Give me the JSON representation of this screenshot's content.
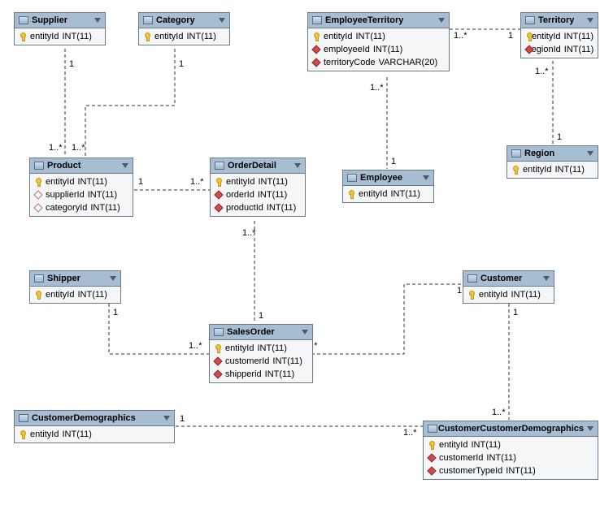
{
  "entities": {
    "supplier": {
      "title": "Supplier",
      "fields": [
        {
          "name": "entityId",
          "type": "INT(11)",
          "icon": "pk"
        }
      ]
    },
    "category": {
      "title": "Category",
      "fields": [
        {
          "name": "entityId",
          "type": "INT(11)",
          "icon": "pk"
        }
      ]
    },
    "employeeTerritory": {
      "title": "EmployeeTerritory",
      "fields": [
        {
          "name": "entityId",
          "type": "INT(11)",
          "icon": "pk"
        },
        {
          "name": "employeeId",
          "type": "INT(11)",
          "icon": "fk"
        },
        {
          "name": "territoryCode",
          "type": "VARCHAR(20)",
          "icon": "fk"
        }
      ]
    },
    "territory": {
      "title": "Territory",
      "fields": [
        {
          "name": "entityId",
          "type": "INT(11)",
          "icon": "pk"
        },
        {
          "name": "regionId",
          "type": "INT(11)",
          "icon": "fk"
        }
      ]
    },
    "product": {
      "title": "Product",
      "fields": [
        {
          "name": "entityId",
          "type": "INT(11)",
          "icon": "pk"
        },
        {
          "name": "supplierId",
          "type": "INT(11)",
          "icon": "fk-o"
        },
        {
          "name": "categoryId",
          "type": "INT(11)",
          "icon": "fk-o"
        }
      ]
    },
    "orderDetail": {
      "title": "OrderDetail",
      "fields": [
        {
          "name": "entityId",
          "type": "INT(11)",
          "icon": "pk"
        },
        {
          "name": "orderId",
          "type": "INT(11)",
          "icon": "fk"
        },
        {
          "name": "productId",
          "type": "INT(11)",
          "icon": "fk"
        }
      ]
    },
    "employee": {
      "title": "Employee",
      "fields": [
        {
          "name": "entityId",
          "type": "INT(11)",
          "icon": "pk"
        }
      ]
    },
    "region": {
      "title": "Region",
      "fields": [
        {
          "name": "entityId",
          "type": "INT(11)",
          "icon": "pk"
        }
      ]
    },
    "shipper": {
      "title": "Shipper",
      "fields": [
        {
          "name": "entityId",
          "type": "INT(11)",
          "icon": "pk"
        }
      ]
    },
    "salesOrder": {
      "title": "SalesOrder",
      "fields": [
        {
          "name": "entityId",
          "type": "INT(11)",
          "icon": "pk"
        },
        {
          "name": "customerId",
          "type": "INT(11)",
          "icon": "fk"
        },
        {
          "name": "shipperid",
          "type": "INT(11)",
          "icon": "fk"
        }
      ]
    },
    "customer": {
      "title": "Customer",
      "fields": [
        {
          "name": "entityId",
          "type": "INT(11)",
          "icon": "pk"
        }
      ]
    },
    "customerDemographics": {
      "title": "CustomerDemographics",
      "fields": [
        {
          "name": "entityId",
          "type": "INT(11)",
          "icon": "pk"
        }
      ]
    },
    "customerCustomerDemographics": {
      "title": "CustomerCustomerDemographics",
      "fields": [
        {
          "name": "entityId",
          "type": "INT(11)",
          "icon": "pk"
        },
        {
          "name": "customerId",
          "type": "INT(11)",
          "icon": "fk"
        },
        {
          "name": "customerTypeId",
          "type": "INT(11)",
          "icon": "fk"
        }
      ]
    }
  },
  "cardinalities": {
    "one": "1",
    "many": "1..*"
  }
}
